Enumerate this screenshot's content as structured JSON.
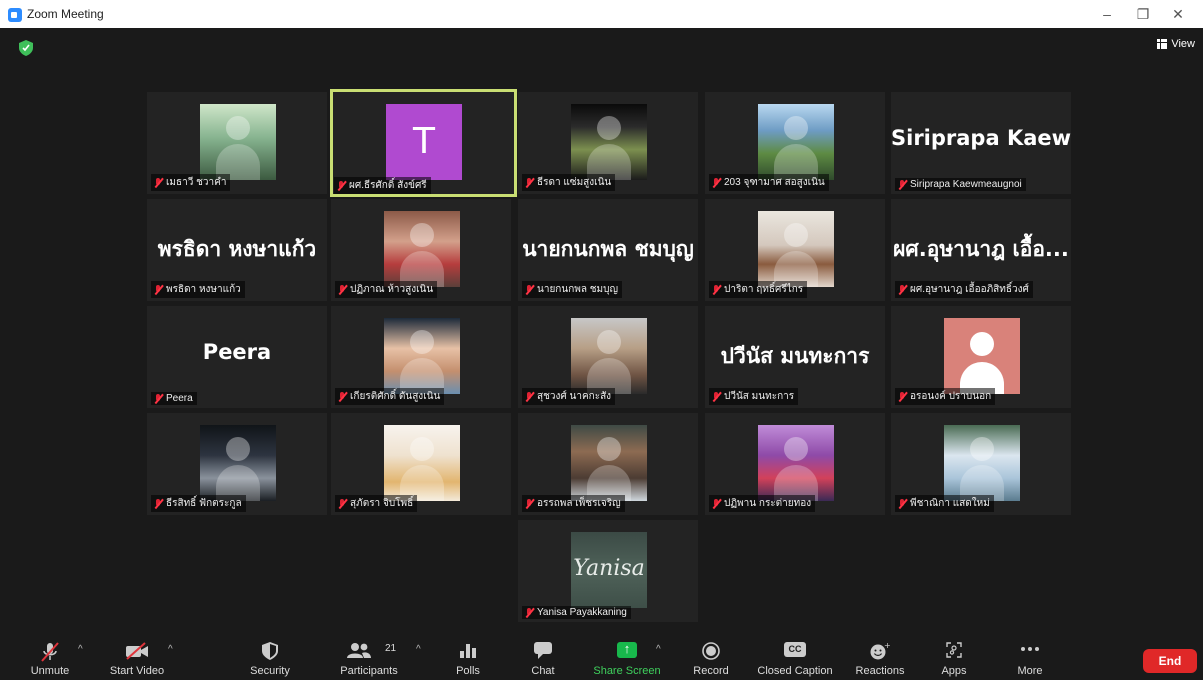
{
  "window": {
    "title": "Zoom Meeting"
  },
  "meeting": {
    "view_label": "View"
  },
  "tiles": [
    {
      "name": "เมธาวี ชวาคำ",
      "big": "",
      "kind": "photo",
      "photo": "p1"
    },
    {
      "name": "ผศ.ธีรศักดิ์ สังข์ศรี",
      "big": "",
      "kind": "letter",
      "letter": "T"
    },
    {
      "name": "ธีรดา แซ่มสูงเนิน",
      "big": "",
      "kind": "photo",
      "photo": "p3"
    },
    {
      "name": "203 จุฑามาศ สอสูงเนิน",
      "big": "",
      "kind": "photo",
      "photo": "p4"
    },
    {
      "name": "Siriprapa Kaewmeaugnoi",
      "big": "Siriprapa  Kaew...",
      "kind": "text"
    },
    {
      "name": "พรธิดา หงษาแก้ว",
      "big": "พรธิดา หงษาแก้ว",
      "kind": "text"
    },
    {
      "name": "ปฏิภาณ ห้าวสูงเนิน",
      "big": "",
      "kind": "photo",
      "photo": "p7"
    },
    {
      "name": "นายกนกพล ชมบุญ",
      "big": "นายกนกพล ชมบุญ",
      "kind": "text"
    },
    {
      "name": "ปาริตา ฤทธิ์ศรีไกร",
      "big": "",
      "kind": "photo",
      "photo": "p9"
    },
    {
      "name": "ผศ.อุษานาฎ เอื้ออภิสิทธิ์วงศ์",
      "big": "ผศ.อุษานาฎ เอื้อ...",
      "kind": "text"
    },
    {
      "name": "Peera",
      "big": "Peera",
      "kind": "text"
    },
    {
      "name": "เกียรติศักดิ์ ตันสูงเนิน",
      "big": "",
      "kind": "photo",
      "photo": "p12"
    },
    {
      "name": "สุชวงศ์ นาคกะสัง",
      "big": "",
      "kind": "photo",
      "photo": "p13"
    },
    {
      "name": "ปวีนัส มนทะการ",
      "big": "ปวีนัส  มนทะการ",
      "kind": "text"
    },
    {
      "name": "อรอนงค์ ปราบนอก",
      "big": "",
      "kind": "default"
    },
    {
      "name": "ธีรสิทธิ์ ฟักตระกูล",
      "big": "",
      "kind": "photo",
      "photo": "p16"
    },
    {
      "name": "สุภัตรา จิบโพธิ์",
      "big": "",
      "kind": "photo",
      "photo": "p17"
    },
    {
      "name": "อรรถพล เพ็ชรเจริญ",
      "big": "",
      "kind": "photo",
      "photo": "p18"
    },
    {
      "name": "ปฏิพาน กระต่ายทอง",
      "big": "",
      "kind": "photo",
      "photo": "p19"
    },
    {
      "name": "พีชาณิกา แสดใหม่",
      "big": "",
      "kind": "photo",
      "photo": "p20"
    },
    {
      "name": "Yanisa Payakkaning",
      "big": "",
      "kind": "photo",
      "photo": "p21",
      "signature": "Yanisa"
    }
  ],
  "toolbar": {
    "unmute": "Unmute",
    "start_video": "Start Video",
    "security": "Security",
    "participants": "Participants",
    "participants_count": "21",
    "polls": "Polls",
    "chat": "Chat",
    "share_screen": "Share Screen",
    "record": "Record",
    "closed_caption": "Closed Caption",
    "cc_icon_text": "CC",
    "reactions": "Reactions",
    "apps": "Apps",
    "more": "More",
    "end": "End"
  },
  "colors": {
    "active_speaker": "#c9de73",
    "end_button": "#e02828",
    "share_green": "#18b84c"
  },
  "icons": [
    "shield-icon",
    "grid-view-icon",
    "mic-muted-icon",
    "video-off-icon",
    "security-shield-icon",
    "participants-icon",
    "polls-icon",
    "chat-icon",
    "share-screen-icon",
    "record-icon",
    "closed-caption-icon",
    "reactions-icon",
    "apps-icon",
    "more-icon"
  ]
}
